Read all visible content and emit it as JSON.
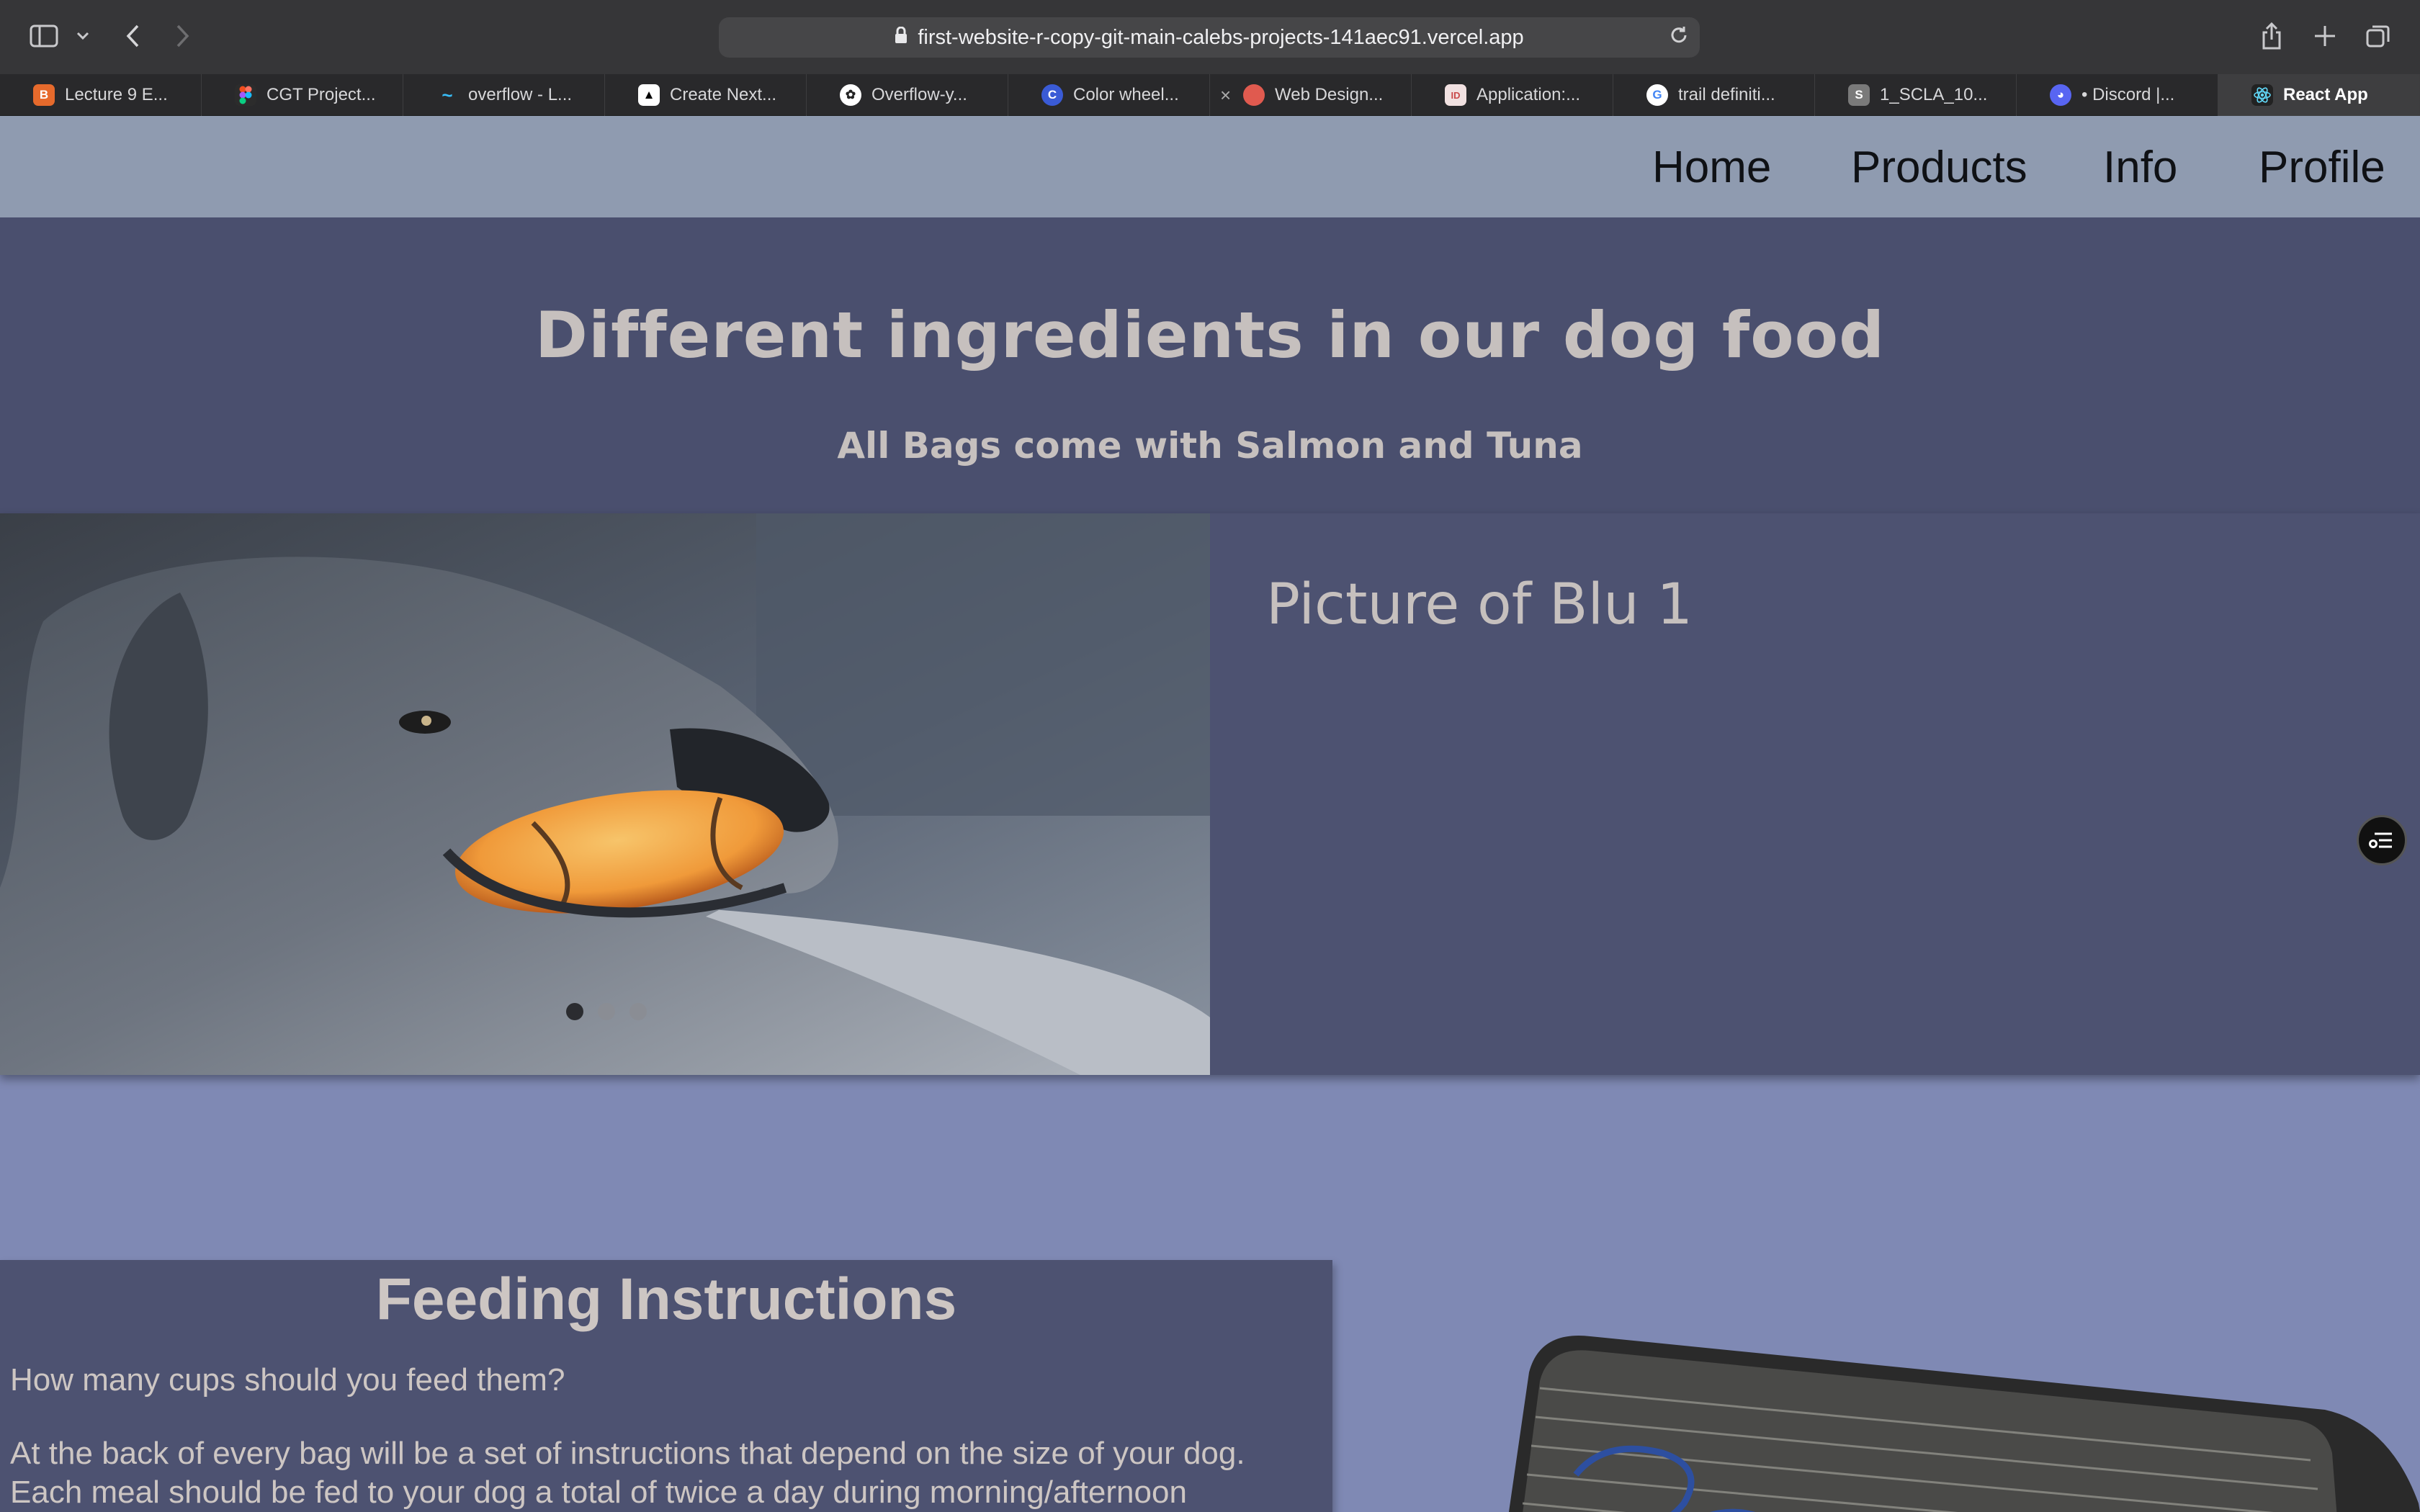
{
  "browser": {
    "url": "first-website-r-copy-git-main-calebs-projects-141aec91.vercel.app",
    "tabs": [
      {
        "label": "Lecture 9 E...",
        "icon": "brave-icon",
        "color": "#e66a2c"
      },
      {
        "label": "CGT Project...",
        "icon": "figma-icon",
        "color": "#f24e1e"
      },
      {
        "label": "overflow - L...",
        "icon": "tailwind-icon",
        "color": "#38bdf8"
      },
      {
        "label": "Create Next...",
        "icon": "nextjs-icon",
        "color": "#000000"
      },
      {
        "label": "Overflow-y...",
        "icon": "openai-icon",
        "color": "#444444"
      },
      {
        "label": "Color wheel...",
        "icon": "canva-icon",
        "color": "#3a5bd6"
      },
      {
        "label": "Web Design...",
        "icon": "web-design-icon",
        "color": "#e05a4f"
      },
      {
        "label": "Application:...",
        "icon": "application-icon",
        "color": "#c94a4a"
      },
      {
        "label": "trail definiti...",
        "icon": "google-icon",
        "color": "#4285f4"
      },
      {
        "label": "1_SCLA_10...",
        "icon": "s-doc-icon",
        "color": "#7a7a7a"
      },
      {
        "label": "• Discord |...",
        "icon": "discord-icon",
        "color": "#5865f2"
      },
      {
        "label": "React App",
        "icon": "react-icon",
        "color": "#61dafb"
      }
    ]
  },
  "nav": {
    "links": [
      "Home",
      "Products",
      "Info",
      "Profile"
    ]
  },
  "hero": {
    "title": "Different ingredients in our dog food",
    "subtitle": "All Bags come with Salmon and Tuna"
  },
  "carousel": {
    "caption": "Picture of Blu 1",
    "slides": 3,
    "active_slide": 1
  },
  "feeding": {
    "title": "Feeding Instructions",
    "question": "How many cups should you feed them?",
    "body_line1": "At the back of every bag will be a set of instructions that depend on the size of your dog.",
    "body_line2": "Each meal should be fed to your dog a total of twice a day during morning/afternoon"
  },
  "colors": {
    "nav_bg": "#8f9bb0",
    "hero_bg": "#4a4f6e",
    "page_bg": "#7f89b4",
    "heading_text": "#c6c0be"
  }
}
